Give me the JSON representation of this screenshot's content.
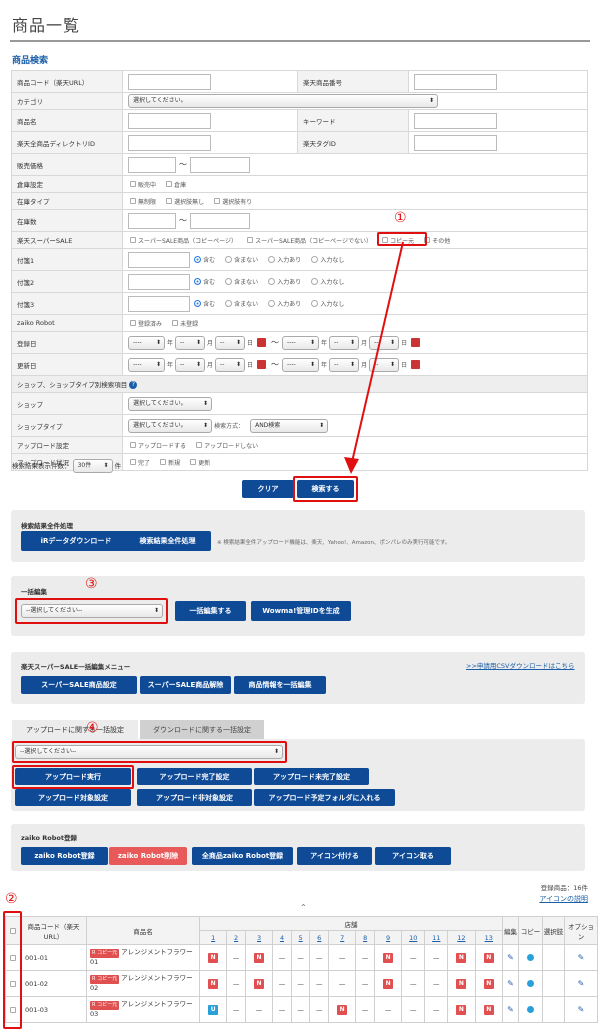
{
  "page": {
    "title": "商品一覧",
    "section_title": "商品検索"
  },
  "form": {
    "product_code": "商品コード（楽天URL）",
    "rakuten_number": "楽天商品番号",
    "category": "カテゴリ",
    "category_select": "選択してください。",
    "product_name": "商品名",
    "keyword": "キーワード",
    "directory": "楽天全商品ディレクトリID",
    "tag": "楽天タグID",
    "price": "販売価格",
    "tilde": "〜",
    "warehouse": "倉庫設定",
    "warehouse_opts": [
      "販売中",
      "倉庫"
    ],
    "stock_type": "在庫タイプ",
    "stock_type_opts": [
      "無制限",
      "選択肢無し",
      "選択肢有り"
    ],
    "stock": "在庫数",
    "sale": "楽天スーパーSALE",
    "sale_opts": [
      "スーパーSALE商品（コピーページ）",
      "スーパーSALE商品（コピーページでない）",
      "コピー元",
      "その他"
    ],
    "tag1": "付箋1",
    "tag2": "付箋2",
    "tag3": "付箋3",
    "tag_opts": [
      "含む",
      "含まない",
      "入力あり",
      "入力なし"
    ],
    "zaiko": "zaiko Robot",
    "zaiko_opts": [
      "登録済み",
      "未登録"
    ],
    "reg_date": "登録日",
    "upd_date": "更新日",
    "date_blank": "----",
    "date_short": "--",
    "y": "年",
    "m": "月",
    "d": "日",
    "shop_header": "ショップ、ショップタイプ別検索項目",
    "help": "?",
    "shop": "ショップ",
    "shop_select": "選択してください。",
    "shop_type": "ショップタイプ",
    "shop_type_select": "選択してください。",
    "search_method": "検索方式：",
    "search_method_value": "AND検索",
    "upload_setting": "アップロード設定",
    "upload_setting_opts": [
      "アップロードする",
      "アップロードしない"
    ],
    "upload_status": "アップロード状況",
    "upload_status_opts": [
      "完了",
      "新規",
      "更新"
    ]
  },
  "results_count": {
    "label": "検索結果表示件数：",
    "value": "30件",
    "unit": "件"
  },
  "buttons": {
    "clear": "クリア",
    "search": "検索する"
  },
  "bulk_process": {
    "title": "検索結果全件処理",
    "ir": "iRデータダウンロード",
    "all": "検索結果全件処理",
    "note": "※ 検索結果全件アップロード機能は、楽天、Yahoo!、Amazon、ポンパレのみ実行可能です。"
  },
  "bulk_edit": {
    "title": "一括編集",
    "select": "--選択してください--",
    "edit": "一括編集する",
    "wowma": "Wowma!管理IDを生成"
  },
  "sale_menu": {
    "title": "楽天スーパーSALE一括編集メニュー",
    "link": ">>申請用CSVダウンロードはこちら",
    "b1": "スーパーSALE商品設定",
    "b2": "スーパーSALE商品解除",
    "b3": "商品情報を一括編集"
  },
  "tabs": {
    "upload": "アップロードに関する一括設定",
    "download": "ダウンロードに関する一括設定"
  },
  "upload_panel": {
    "select": "--選択してください--",
    "b1": "アップロード実行",
    "b2": "アップロード完了設定",
    "b3": "アップロード未完了設定",
    "b4": "アップロード対象設定",
    "b5": "アップロード非対象設定",
    "b6": "アップロード予定フォルダに入れる"
  },
  "zaiko_panel": {
    "title": "zaiko Robot登録",
    "b1": "zaiko Robot登録",
    "b2": "zaiko Robot削除",
    "b3": "全商品zaiko Robot登録",
    "b4": "アイコン付ける",
    "b5": "アイコン取る"
  },
  "reg_count": "登録商品：16件",
  "icon_help": "アイコンの説明",
  "caret": "⌃",
  "annotations": {
    "c1": "①",
    "c2": "②",
    "c3": "③",
    "c4": "④"
  },
  "table": {
    "code_header": "商品コード（楽天URL）",
    "name_header": "商品名",
    "shop_header": "店舗",
    "shops": [
      "1",
      "2",
      "3",
      "4",
      "5",
      "6",
      "7",
      "8",
      "9",
      "10",
      "11",
      "12",
      "13"
    ],
    "edit": "編集",
    "copy": "コピー",
    "choice": "選択肢",
    "option": "オプション",
    "rak": "R コピー元",
    "rows": [
      {
        "code": "001-01",
        "name": "アレンジメントフラワー01",
        "cells": [
          "N",
          "—",
          "N",
          "—",
          "—",
          "—",
          "—",
          "—",
          "N",
          "—",
          "—",
          "N",
          "N"
        ]
      },
      {
        "code": "001-02",
        "name": "アレンジメントフラワー02",
        "cells": [
          "N",
          "—",
          "N",
          "—",
          "—",
          "—",
          "—",
          "—",
          "N",
          "—",
          "—",
          "N",
          "N"
        ]
      },
      {
        "code": "001-03",
        "name": "アレンジメントフラワー03",
        "cells": [
          "U",
          "—",
          "—",
          "—",
          "—",
          "—",
          "N",
          "—",
          "—",
          "—",
          "—",
          "N",
          "N"
        ]
      }
    ]
  },
  "colors": {
    "accent": "#0e4a96",
    "annotation": "#e01010",
    "delete": "#e85a5a"
  }
}
